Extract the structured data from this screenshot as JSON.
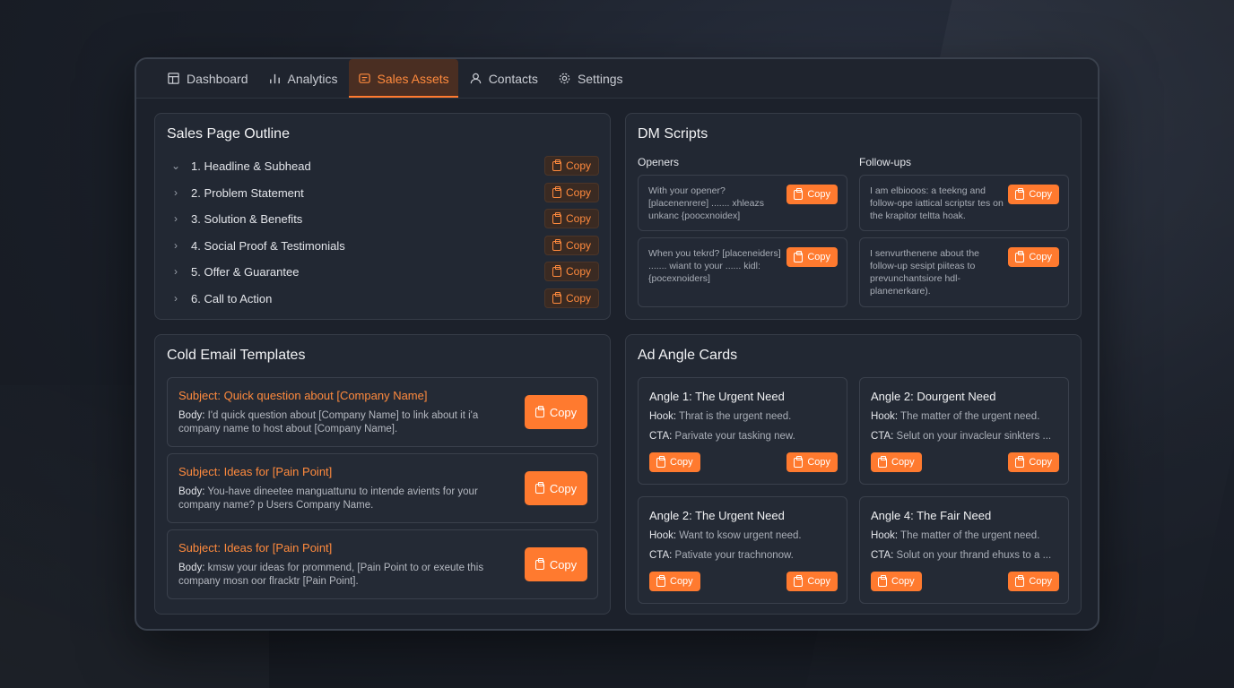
{
  "tabs": [
    {
      "label": "Dashboard",
      "icon": "dashboard-icon"
    },
    {
      "label": "Analytics",
      "icon": "bar-chart-icon"
    },
    {
      "label": "Sales Assets",
      "icon": "folder-icon",
      "active": true
    },
    {
      "label": "Contacts",
      "icon": "user-icon"
    },
    {
      "label": "Settings",
      "icon": "gear-icon"
    }
  ],
  "copy_label": "Copy",
  "outline": {
    "title": "Sales Page Outline",
    "items": [
      "1. Headline & Subhead",
      "2. Problem Statement",
      "3. Solution & Benefits",
      "4. Social Proof & Testimonials",
      "5. Offer & Guarantee",
      "6. Call to Action"
    ]
  },
  "dm": {
    "title": "DM Scripts",
    "openers_label": "Openers",
    "followups_label": "Follow-ups",
    "openers": [
      "With your opener? [placenenrere] ....... xhleazs unkanc {poocxnoidex]",
      "When you tekrd? [placeneiders] ....... wiant to your ...... kidl: {pocexnoiders]"
    ],
    "followups": [
      "I am elbiooos: a teekng and follow-ope iattical scriptsr tes on the krapitor teltta hoak.",
      "I senvurthenene about the follow-up sesipt piiteas to prevunchantsiore hdl- planenerkare)."
    ]
  },
  "email": {
    "title": "Cold Email Templates",
    "body_label": "Body:",
    "items": [
      {
        "subject": "Subject: Quick question about [Company Name]",
        "body": "I'd quick question about [Company Name] to link about it i'a company name to host about [Company Name]."
      },
      {
        "subject": "Subject: Ideas for [Pain Point]",
        "body": "You-have dineetee manguattunu to intende avients for your company name? p Users Company Name."
      },
      {
        "subject": "Subject: Ideas for [Pain Point]",
        "body": "kmsw your ideas for prommend, [Pain Point to or exeute this company mosn oor flracktr [Pain Point]."
      }
    ]
  },
  "ads": {
    "title": "Ad Angle Cards",
    "hook_label": "Hook:",
    "cta_label": "CTA:",
    "items": [
      {
        "title": "Angle 1: The Urgent Need",
        "hook": "Thrat is the urgent need.",
        "cta": "Parivate your tasking new."
      },
      {
        "title": "Angle 2: Dourgent Need",
        "hook": "The matter of the urgent need.",
        "cta": "Selut on your invacleur sinkters ..."
      },
      {
        "title": "Angle 2: The Urgent Need",
        "hook": "Want to ksow urgent need.",
        "cta": "Pativate your trachnonow."
      },
      {
        "title": "Angle 4: The Fair Need",
        "hook": "The matter of the urgent need.",
        "cta": "Solut on your thrand ehuxs to a ..."
      }
    ]
  }
}
